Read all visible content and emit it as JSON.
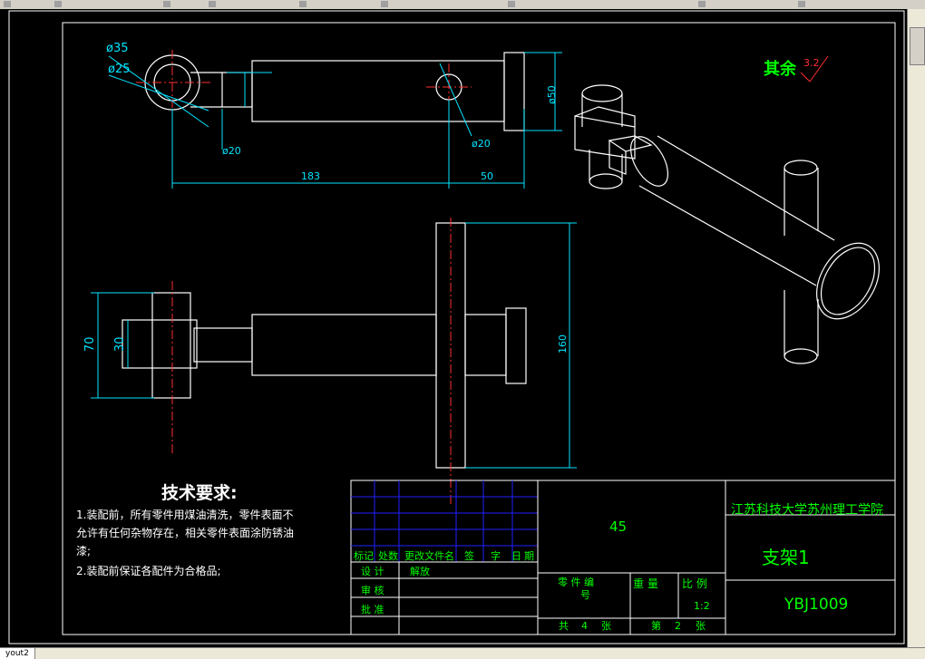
{
  "layout_tab": "yout2",
  "dimensions": {
    "d35": "ø35",
    "d25": "ø25",
    "d20_left": "ø20",
    "d20_right": "ø20",
    "d50": "ø50",
    "len183": "183",
    "len50": "50",
    "h70": "70",
    "h30": "30",
    "h160": "160"
  },
  "surface_finish": {
    "label": "其余",
    "value": "3.2"
  },
  "tech_requirements": {
    "title": "技术要求:",
    "lines": [
      "1.装配前，所有零件用煤油清洗，零件表面不",
      "允许有任何杂物存在，相关零件表面涂防锈油",
      "漆;",
      "2.装配前保证各配件为合格品;"
    ]
  },
  "title_block": {
    "material": "45",
    "school": "江苏科技大学苏州理工学院",
    "part_name": "支架1",
    "drawing_no": "YBJ1009",
    "rev_headers": [
      "标记",
      "处数",
      "更改文件名",
      "签",
      "字",
      "日",
      "期"
    ],
    "design_label": "设  计",
    "designer": "解放",
    "review_label": "审  核",
    "approve_label": "批  准",
    "part_label": "零  件  编",
    "part_label2": "号",
    "weight_label": "重    量",
    "scale_label": "比    例",
    "scale_value": "1:2",
    "total_label": "共",
    "total_value": "4",
    "total_unit": "张",
    "sheet_label": "第",
    "sheet_value": "2",
    "sheet_unit": "张"
  },
  "colors": {
    "outline": "#ffffff",
    "dimension": "#00e5ff",
    "centerline": "#ff3030",
    "title_green": "#00ff00",
    "grid_blue": "#2020ff"
  }
}
